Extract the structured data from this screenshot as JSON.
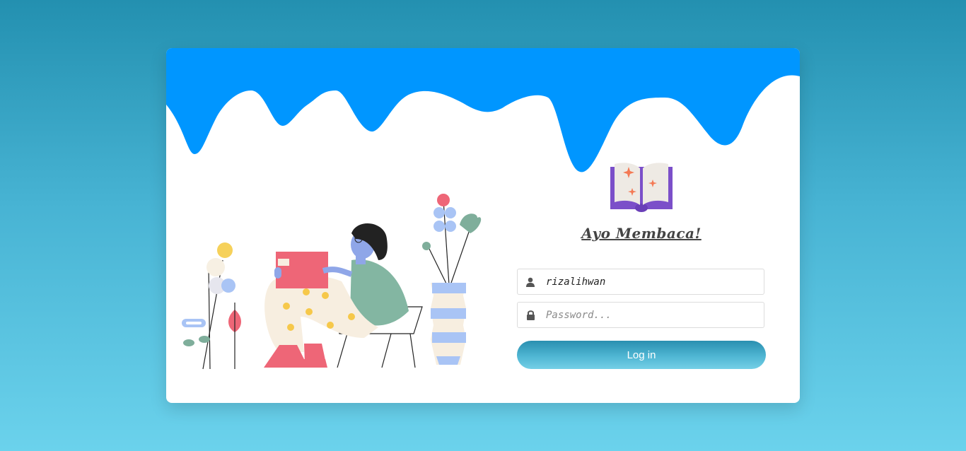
{
  "brand": {
    "title": "Ayo Membaca!"
  },
  "login": {
    "username_value": "rizalihwan",
    "password_placeholder": "Password...",
    "submit_label": "Log in"
  },
  "icons": {
    "username": "user-icon",
    "password": "lock-icon",
    "logo": "open-book-icon"
  },
  "colors": {
    "background_top": "#2390b0",
    "background_bottom": "#6bd2ec",
    "wave": "#0096ff",
    "button_top": "#2a8fb0",
    "button_bottom": "#74cfe6",
    "book_cover": "#7b4fc9"
  }
}
